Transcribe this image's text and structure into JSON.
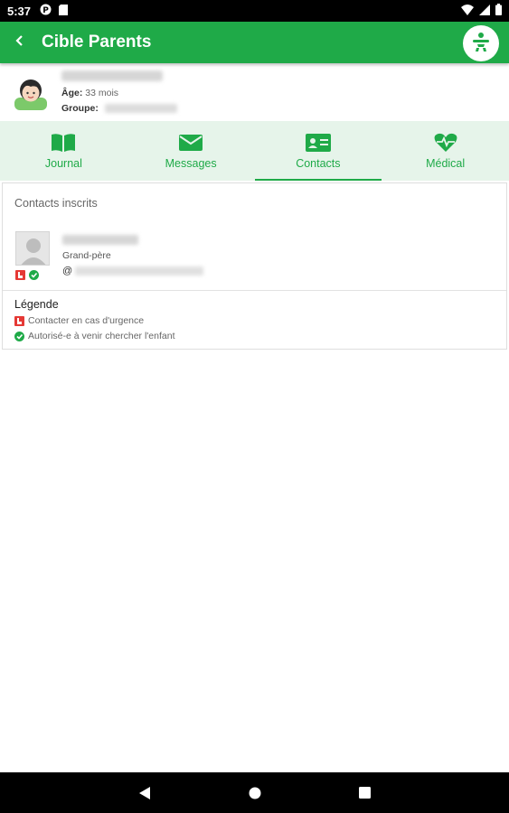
{
  "status_bar": {
    "time": "5:37",
    "icons": [
      "p-icon",
      "sim-icon",
      "wifi-icon",
      "signal-icon",
      "battery-icon"
    ]
  },
  "app_bar": {
    "title": "Cible Parents",
    "back_icon": "back-arrow-icon",
    "logo_icon": "app-logo-icon"
  },
  "child": {
    "age_label": "Âge:",
    "age_value": "33 mois",
    "group_label": "Groupe:"
  },
  "tabs": [
    {
      "label": "Journal",
      "icon": "book-icon",
      "active": false
    },
    {
      "label": "Messages",
      "icon": "envelope-icon",
      "active": false
    },
    {
      "label": "Contacts",
      "icon": "contact-card-icon",
      "active": true
    },
    {
      "label": "Médical",
      "icon": "heartbeat-icon",
      "active": false
    }
  ],
  "contacts": {
    "section_title": "Contacts inscrits",
    "items": [
      {
        "relation": "Grand-père",
        "email_prefix": "@"
      }
    ]
  },
  "legend": {
    "title": "Légende",
    "emergency": "Contacter en cas d'urgence",
    "pickup": "Autorisé-e à venir chercher l'enfant"
  },
  "colors": {
    "primary": "#1faa48",
    "tab_bg": "#e6f4ea",
    "emergency": "#e53935"
  }
}
